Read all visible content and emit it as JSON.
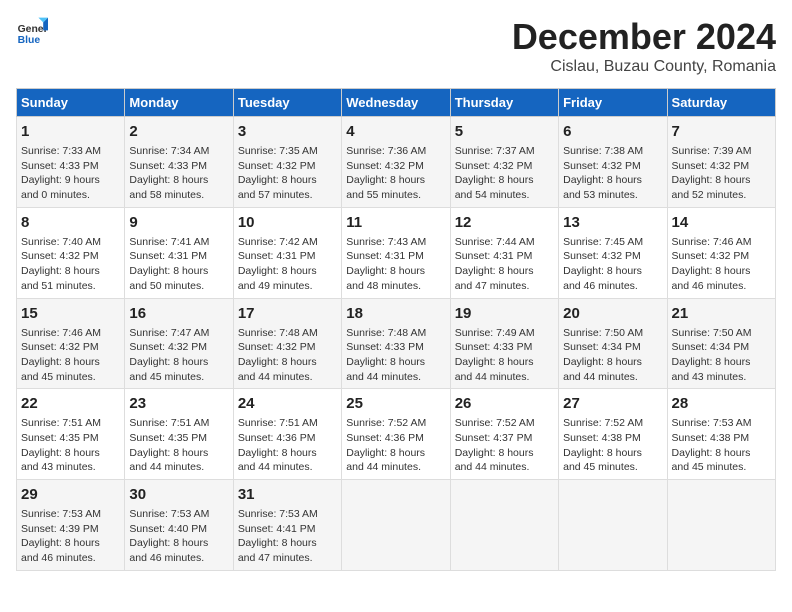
{
  "logo": {
    "line1": "General",
    "line2": "Blue"
  },
  "title": "December 2024",
  "subtitle": "Cislau, Buzau County, Romania",
  "header_color": "#1565c0",
  "days_of_week": [
    "Sunday",
    "Monday",
    "Tuesday",
    "Wednesday",
    "Thursday",
    "Friday",
    "Saturday"
  ],
  "weeks": [
    [
      {
        "day": "1",
        "info": "Sunrise: 7:33 AM\nSunset: 4:33 PM\nDaylight: 9 hours\nand 0 minutes."
      },
      {
        "day": "2",
        "info": "Sunrise: 7:34 AM\nSunset: 4:33 PM\nDaylight: 8 hours\nand 58 minutes."
      },
      {
        "day": "3",
        "info": "Sunrise: 7:35 AM\nSunset: 4:32 PM\nDaylight: 8 hours\nand 57 minutes."
      },
      {
        "day": "4",
        "info": "Sunrise: 7:36 AM\nSunset: 4:32 PM\nDaylight: 8 hours\nand 55 minutes."
      },
      {
        "day": "5",
        "info": "Sunrise: 7:37 AM\nSunset: 4:32 PM\nDaylight: 8 hours\nand 54 minutes."
      },
      {
        "day": "6",
        "info": "Sunrise: 7:38 AM\nSunset: 4:32 PM\nDaylight: 8 hours\nand 53 minutes."
      },
      {
        "day": "7",
        "info": "Sunrise: 7:39 AM\nSunset: 4:32 PM\nDaylight: 8 hours\nand 52 minutes."
      }
    ],
    [
      {
        "day": "8",
        "info": "Sunrise: 7:40 AM\nSunset: 4:32 PM\nDaylight: 8 hours\nand 51 minutes."
      },
      {
        "day": "9",
        "info": "Sunrise: 7:41 AM\nSunset: 4:31 PM\nDaylight: 8 hours\nand 50 minutes."
      },
      {
        "day": "10",
        "info": "Sunrise: 7:42 AM\nSunset: 4:31 PM\nDaylight: 8 hours\nand 49 minutes."
      },
      {
        "day": "11",
        "info": "Sunrise: 7:43 AM\nSunset: 4:31 PM\nDaylight: 8 hours\nand 48 minutes."
      },
      {
        "day": "12",
        "info": "Sunrise: 7:44 AM\nSunset: 4:31 PM\nDaylight: 8 hours\nand 47 minutes."
      },
      {
        "day": "13",
        "info": "Sunrise: 7:45 AM\nSunset: 4:32 PM\nDaylight: 8 hours\nand 46 minutes."
      },
      {
        "day": "14",
        "info": "Sunrise: 7:46 AM\nSunset: 4:32 PM\nDaylight: 8 hours\nand 46 minutes."
      }
    ],
    [
      {
        "day": "15",
        "info": "Sunrise: 7:46 AM\nSunset: 4:32 PM\nDaylight: 8 hours\nand 45 minutes."
      },
      {
        "day": "16",
        "info": "Sunrise: 7:47 AM\nSunset: 4:32 PM\nDaylight: 8 hours\nand 45 minutes."
      },
      {
        "day": "17",
        "info": "Sunrise: 7:48 AM\nSunset: 4:32 PM\nDaylight: 8 hours\nand 44 minutes."
      },
      {
        "day": "18",
        "info": "Sunrise: 7:48 AM\nSunset: 4:33 PM\nDaylight: 8 hours\nand 44 minutes."
      },
      {
        "day": "19",
        "info": "Sunrise: 7:49 AM\nSunset: 4:33 PM\nDaylight: 8 hours\nand 44 minutes."
      },
      {
        "day": "20",
        "info": "Sunrise: 7:50 AM\nSunset: 4:34 PM\nDaylight: 8 hours\nand 44 minutes."
      },
      {
        "day": "21",
        "info": "Sunrise: 7:50 AM\nSunset: 4:34 PM\nDaylight: 8 hours\nand 43 minutes."
      }
    ],
    [
      {
        "day": "22",
        "info": "Sunrise: 7:51 AM\nSunset: 4:35 PM\nDaylight: 8 hours\nand 43 minutes."
      },
      {
        "day": "23",
        "info": "Sunrise: 7:51 AM\nSunset: 4:35 PM\nDaylight: 8 hours\nand 44 minutes."
      },
      {
        "day": "24",
        "info": "Sunrise: 7:51 AM\nSunset: 4:36 PM\nDaylight: 8 hours\nand 44 minutes."
      },
      {
        "day": "25",
        "info": "Sunrise: 7:52 AM\nSunset: 4:36 PM\nDaylight: 8 hours\nand 44 minutes."
      },
      {
        "day": "26",
        "info": "Sunrise: 7:52 AM\nSunset: 4:37 PM\nDaylight: 8 hours\nand 44 minutes."
      },
      {
        "day": "27",
        "info": "Sunrise: 7:52 AM\nSunset: 4:38 PM\nDaylight: 8 hours\nand 45 minutes."
      },
      {
        "day": "28",
        "info": "Sunrise: 7:53 AM\nSunset: 4:38 PM\nDaylight: 8 hours\nand 45 minutes."
      }
    ],
    [
      {
        "day": "29",
        "info": "Sunrise: 7:53 AM\nSunset: 4:39 PM\nDaylight: 8 hours\nand 46 minutes."
      },
      {
        "day": "30",
        "info": "Sunrise: 7:53 AM\nSunset: 4:40 PM\nDaylight: 8 hours\nand 46 minutes."
      },
      {
        "day": "31",
        "info": "Sunrise: 7:53 AM\nSunset: 4:41 PM\nDaylight: 8 hours\nand 47 minutes."
      },
      {
        "day": "",
        "info": ""
      },
      {
        "day": "",
        "info": ""
      },
      {
        "day": "",
        "info": ""
      },
      {
        "day": "",
        "info": ""
      }
    ]
  ]
}
